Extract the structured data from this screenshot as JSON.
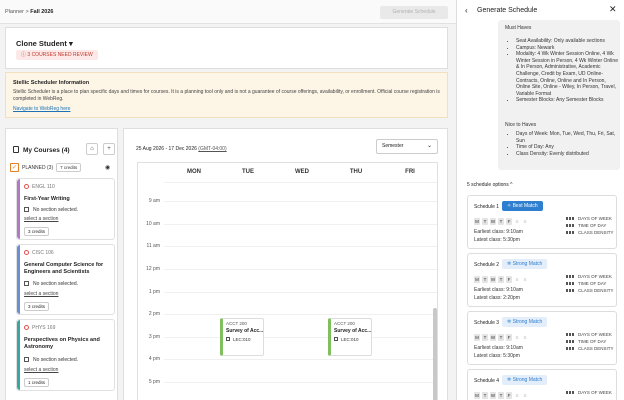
{
  "breadcrumb": {
    "parent": "Planner",
    "sep": ">",
    "current": "Fall 2026"
  },
  "topbar": {
    "generate_label": "Generate Schedule"
  },
  "student": {
    "name": "Clone Student",
    "caret": "▾",
    "review_badge": "3 COURSES NEED REVIEW"
  },
  "info": {
    "title": "Stellic Scheduler Information",
    "text": "Stellic Scheduler is a place to plan specific days and times for courses. It is a planning tool only and is not a guarantee of course offerings, availability, or enrollment. Official course registration is completed in WebReg.",
    "link": "Navigate to WebReg here"
  },
  "courses": {
    "header": "My Courses (4)",
    "planned_label": "PLANNED (3)",
    "planned_credits": "7 credits",
    "items": [
      {
        "code": "ENGL 110",
        "title": "First-Year Writing",
        "no_section": "No section selected.",
        "select": "select a section",
        "credits": "3 credits",
        "color": "#b07ac9"
      },
      {
        "code": "CISC 106",
        "title": "General Computer Science for Engineers and Scientists",
        "no_section": "No section selected.",
        "select": "select a section",
        "credits": "3 credits",
        "color": "#6b8fd6"
      },
      {
        "code": "PHYS 169",
        "title": "Perspectives on Physics and Astronomy",
        "no_section": "No section selected.",
        "select": "select a section",
        "credits": "1 credits",
        "color": "#3aa6a0"
      }
    ]
  },
  "calendar": {
    "date_range": "25 Aug 2026 - 17 Dec 2026",
    "timezone": "(GMT-04:00)",
    "semester": "Semester",
    "days": [
      "MON",
      "TUE",
      "WED",
      "THU",
      "FRI"
    ],
    "hours": [
      "9 am",
      "10 am",
      "11 am",
      "12 pm",
      "1 pm",
      "2 pm",
      "3 pm",
      "4 pm",
      "5 pm"
    ],
    "events": [
      {
        "code": "ACCT 200",
        "title": "Survey of Acc...",
        "section": "LEC:010",
        "day": "TUE"
      },
      {
        "code": "ACCT 200",
        "title": "Survey of Acc...",
        "section": "LEC:010",
        "day": "THU"
      }
    ]
  },
  "panel": {
    "title": "Generate Schedule",
    "must_haves_label": "Must Haves",
    "must_haves": [
      "Seat Availability: Only available sections",
      "Campus: Newark",
      "Modality: 4 Wk Winter Session Online, 4 Wk Winter Session in Person, 4 Wk Winter Online & In Person, Administrative, Academic Challenge, Credit by Exam, UD Online- Contracts, Online, Online and In Person, Online Site, Online - Wiley, In Person, Travel, Variable Format",
      "Semester Blocks: Any Semester Blocks"
    ],
    "nice_label": "Nice to Haves",
    "nice_to_haves": [
      "Days of Week: Mon, Tue, Wed, Thu, Fri, Sat, Sun",
      "Time of Day: Any",
      "Class Density: Evenly distributed"
    ],
    "options_label": "5 schedule options",
    "metric_labels": [
      "DAYS OF WEEK",
      "TIME OF DAY",
      "CLASS DENSITY"
    ],
    "schedules": [
      {
        "name": "Schedule 1",
        "tag": "Best Match",
        "tag_icon": "✧",
        "early": "Earliest class: 9:10am",
        "late": "Latest class: 5:30pm"
      },
      {
        "name": "Schedule 2",
        "tag": "Strong Match",
        "tag_icon": "✲",
        "early": "Earliest class: 9:10am",
        "late": "Latest class: 2:20pm"
      },
      {
        "name": "Schedule 3",
        "tag": "Strong Match",
        "tag_icon": "✲",
        "early": "Earliest class: 9:10am",
        "late": "Latest class: 5:30pm"
      },
      {
        "name": "Schedule 4",
        "tag": "Strong Match",
        "tag_icon": "✲"
      }
    ],
    "day_letters": [
      "M",
      "T",
      "W",
      "T",
      "F",
      "S",
      "S"
    ]
  }
}
